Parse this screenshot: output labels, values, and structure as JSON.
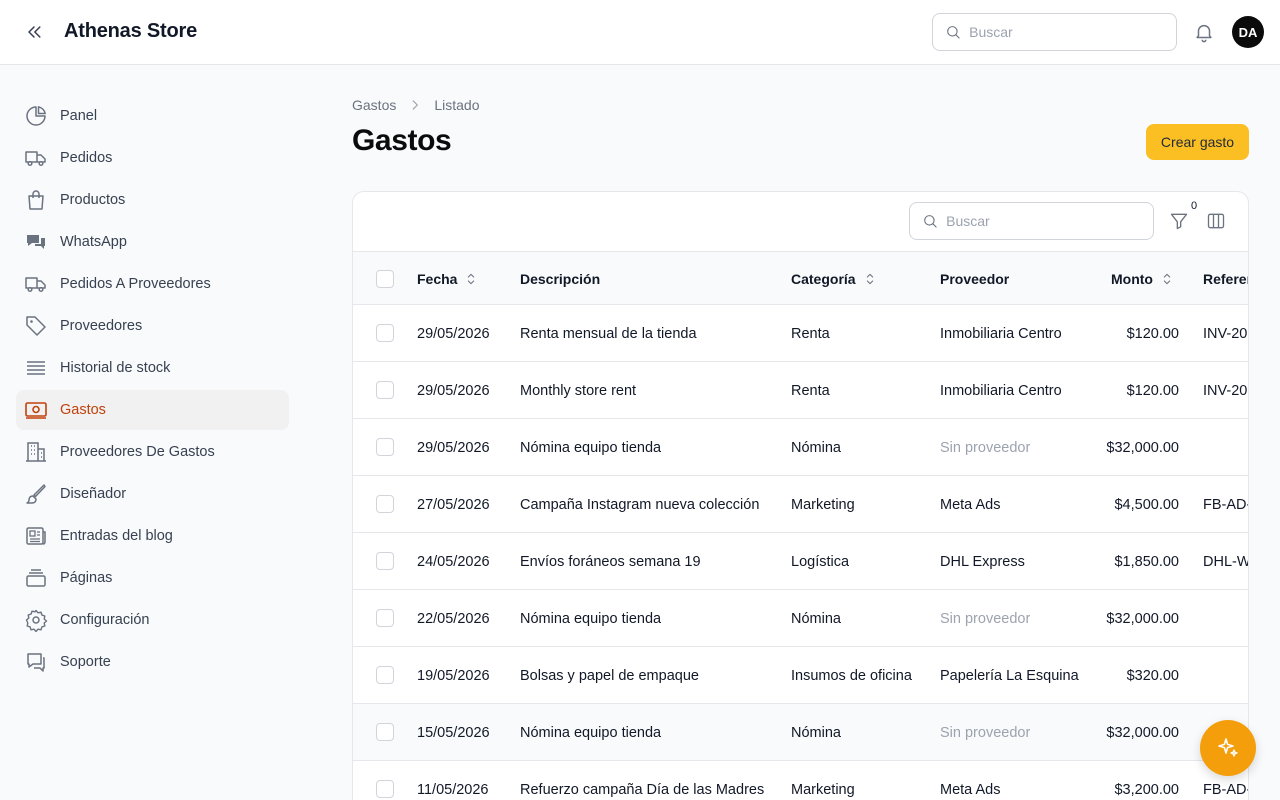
{
  "app": {
    "title": "Athenas Store",
    "avatar_initials": "DA",
    "accent": "#fbbf24",
    "active_color": "#c2410c"
  },
  "header": {
    "search_placeholder": "Buscar",
    "notification_icon": "bell-icon",
    "collapse_icon": "chevrons-left-icon"
  },
  "sidebar": {
    "items": [
      {
        "label": "Panel",
        "icon": "pie-chart-icon"
      },
      {
        "label": "Pedidos",
        "icon": "truck-icon"
      },
      {
        "label": "Productos",
        "icon": "shopping-bag-icon"
      },
      {
        "label": "WhatsApp",
        "icon": "chat-bubbles-icon"
      },
      {
        "label": "Pedidos A Proveedores",
        "icon": "truck-icon"
      },
      {
        "label": "Proveedores",
        "icon": "tag-icon"
      },
      {
        "label": "Historial de stock",
        "icon": "stack-icon"
      },
      {
        "label": "Gastos",
        "icon": "banknote-icon",
        "active": true
      },
      {
        "label": "Proveedores De Gastos",
        "icon": "building-icon"
      },
      {
        "label": "Diseñador",
        "icon": "paintbrush-icon"
      },
      {
        "label": "Entradas del blog",
        "icon": "newspaper-icon"
      },
      {
        "label": "Páginas",
        "icon": "pages-stack-icon"
      },
      {
        "label": "Configuración",
        "icon": "gear-icon"
      },
      {
        "label": "Soporte",
        "icon": "support-chat-icon"
      }
    ]
  },
  "breadcrumb": {
    "parent": "Gastos",
    "current": "Listado"
  },
  "page": {
    "title": "Gastos",
    "create_label": "Crear gasto"
  },
  "table": {
    "search_placeholder": "Buscar",
    "filter_count": "0",
    "columns": {
      "date": "Fecha",
      "description": "Descripción",
      "category": "Categoría",
      "provider": "Proveedor",
      "amount": "Monto",
      "reference": "Referencia"
    },
    "rows": [
      {
        "date": "29/05/2026",
        "description": "Renta mensual de la tienda",
        "category": "Renta",
        "provider": "Inmobiliaria Centro",
        "provider_muted": false,
        "amount": "$120.00",
        "reference": "INV-20"
      },
      {
        "date": "29/05/2026",
        "description": "Monthly store rent",
        "category": "Renta",
        "provider": "Inmobiliaria Centro",
        "provider_muted": false,
        "amount": "$120.00",
        "reference": "INV-20"
      },
      {
        "date": "29/05/2026",
        "description": "Nómina equipo tienda",
        "category": "Nómina",
        "provider": "Sin proveedor",
        "provider_muted": true,
        "amount": "$32,000.00",
        "reference": ""
      },
      {
        "date": "27/05/2026",
        "description": "Campaña Instagram nueva colección",
        "category": "Marketing",
        "provider": "Meta Ads",
        "provider_muted": false,
        "amount": "$4,500.00",
        "reference": "FB-AD-"
      },
      {
        "date": "24/05/2026",
        "description": "Envíos foráneos semana 19",
        "category": "Logística",
        "provider": "DHL Express",
        "provider_muted": false,
        "amount": "$1,850.00",
        "reference": "DHL-W"
      },
      {
        "date": "22/05/2026",
        "description": "Nómina equipo tienda",
        "category": "Nómina",
        "provider": "Sin proveedor",
        "provider_muted": true,
        "amount": "$32,000.00",
        "reference": ""
      },
      {
        "date": "19/05/2026",
        "description": "Bolsas y papel de empaque",
        "category": "Insumos de oficina",
        "provider": "Papelería La Esquina",
        "provider_muted": false,
        "amount": "$320.00",
        "reference": ""
      },
      {
        "date": "15/05/2026",
        "description": "Nómina equipo tienda",
        "category": "Nómina",
        "provider": "Sin proveedor",
        "provider_muted": true,
        "amount": "$32,000.00",
        "reference": ""
      },
      {
        "date": "11/05/2026",
        "description": "Refuerzo campaña Día de las Madres",
        "category": "Marketing",
        "provider": "Meta Ads",
        "provider_muted": false,
        "amount": "$3,200.00",
        "reference": "FB-AD-"
      }
    ]
  },
  "fab": {
    "icon": "sparkles-icon"
  }
}
